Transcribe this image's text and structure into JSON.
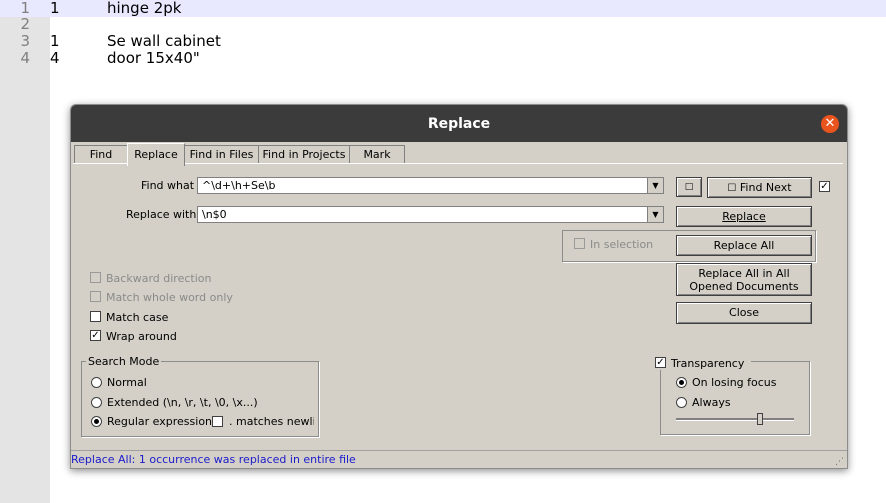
{
  "editor": {
    "lines": [
      {
        "num": "1",
        "col_a": "1",
        "col_b": "hinge 2pk"
      },
      {
        "num": "2",
        "col_a": "",
        "col_b": ""
      },
      {
        "num": "3",
        "col_a": "1",
        "col_b": "Se wall cabinet"
      },
      {
        "num": "4",
        "col_a": "4",
        "col_b": "door 15x40\""
      }
    ]
  },
  "dialog": {
    "title": "Replace",
    "close_icon": "close-icon",
    "tabs": [
      "Find",
      "Replace",
      "Find in Files",
      "Find in Projects",
      "Mark"
    ],
    "active_tab": "Replace",
    "find_label": "Find what :",
    "find_value": "^\\d+\\h+Se\\b",
    "replace_label": "Replace with",
    "replace_value": "\\n$0",
    "buttons": {
      "find_next": "Find Next",
      "replace": "Replace",
      "replace_all": "Replace All",
      "replace_all_opened_1": "Replace All in All",
      "replace_all_opened_2": "Opened Documents",
      "close": "Close"
    },
    "in_selection": "In selection",
    "options": {
      "backward": "Backward direction",
      "whole_word": "Match whole word only",
      "match_case": "Match case",
      "wrap_around": "Wrap around"
    },
    "search_mode": {
      "legend": "Search Mode",
      "normal": "Normal",
      "extended": "Extended (\\n, \\r, \\t, \\0, \\x...)",
      "regex": "Regular expression",
      "dot_newline": ". matches newline",
      "selected": "regex"
    },
    "transparency": {
      "label": "Transparency",
      "on_losing_focus": "On losing focus",
      "always": "Always",
      "checked": true,
      "selected": "on_losing_focus",
      "level": 0.7
    },
    "status": "Replace All: 1 occurrence was replaced in entire file"
  }
}
